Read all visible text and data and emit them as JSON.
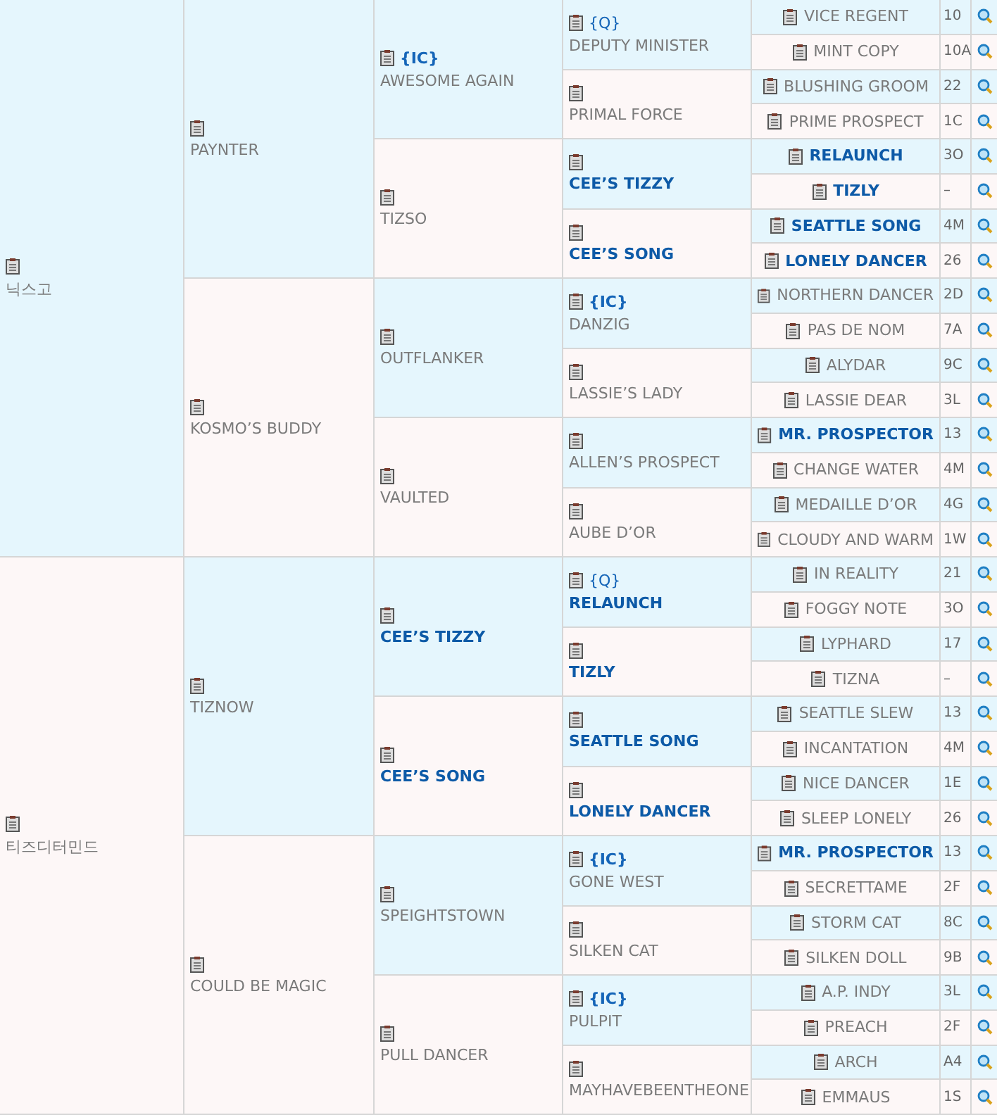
{
  "pedigree": [
    {
      "name": "닉스고",
      "highlighted": false,
      "children": [
        {
          "name": "PAYNTER",
          "highlighted": false,
          "children": [
            {
              "name": "AWESOME AGAIN",
              "tag": "{IC}",
              "highlighted": false,
              "children": [
                {
                  "name": "DEPUTY MINISTER",
                  "tag": "{Q}",
                  "highlighted": false,
                  "children": [
                    {
                      "name": "VICE REGENT",
                      "highlighted": false,
                      "code": "10"
                    },
                    {
                      "name": "MINT COPY",
                      "highlighted": false,
                      "code": "10A"
                    }
                  ]
                },
                {
                  "name": "PRIMAL FORCE",
                  "highlighted": false,
                  "children": [
                    {
                      "name": "BLUSHING GROOM",
                      "highlighted": false,
                      "code": "22"
                    },
                    {
                      "name": "PRIME PROSPECT",
                      "highlighted": false,
                      "code": "1C"
                    }
                  ]
                }
              ]
            },
            {
              "name": "TIZSO",
              "highlighted": false,
              "children": [
                {
                  "name": "CEE’S TIZZY",
                  "highlighted": true,
                  "children": [
                    {
                      "name": "RELAUNCH",
                      "highlighted": true,
                      "code": "3O"
                    },
                    {
                      "name": "TIZLY",
                      "highlighted": true,
                      "code": "–"
                    }
                  ]
                },
                {
                  "name": "CEE’S SONG",
                  "highlighted": true,
                  "children": [
                    {
                      "name": "SEATTLE SONG",
                      "highlighted": true,
                      "code": "4M"
                    },
                    {
                      "name": "LONELY DANCER",
                      "highlighted": true,
                      "code": "26"
                    }
                  ]
                }
              ]
            }
          ]
        },
        {
          "name": "KOSMO’S BUDDY",
          "highlighted": false,
          "children": [
            {
              "name": "OUTFLANKER",
              "highlighted": false,
              "children": [
                {
                  "name": "DANZIG",
                  "tag": "{IC}",
                  "highlighted": false,
                  "children": [
                    {
                      "name": "NORTHERN DANCER",
                      "highlighted": false,
                      "code": "2D"
                    },
                    {
                      "name": "PAS DE NOM",
                      "highlighted": false,
                      "code": "7A"
                    }
                  ]
                },
                {
                  "name": "LASSIE’S LADY",
                  "highlighted": false,
                  "children": [
                    {
                      "name": "ALYDAR",
                      "highlighted": false,
                      "code": "9C"
                    },
                    {
                      "name": "LASSIE DEAR",
                      "highlighted": false,
                      "code": "3L"
                    }
                  ]
                }
              ]
            },
            {
              "name": "VAULTED",
              "highlighted": false,
              "children": [
                {
                  "name": "ALLEN’S PROSPECT",
                  "highlighted": false,
                  "children": [
                    {
                      "name": "MR. PROSPECTOR",
                      "highlighted": true,
                      "code": "13"
                    },
                    {
                      "name": "CHANGE WATER",
                      "highlighted": false,
                      "code": "4M"
                    }
                  ]
                },
                {
                  "name": "AUBE D’OR",
                  "highlighted": false,
                  "children": [
                    {
                      "name": "MEDAILLE D’OR",
                      "highlighted": false,
                      "code": "4G"
                    },
                    {
                      "name": "CLOUDY AND WARM",
                      "highlighted": false,
                      "code": "1W"
                    }
                  ]
                }
              ]
            }
          ]
        }
      ]
    },
    {
      "name": "티즈디터민드",
      "highlighted": false,
      "children": [
        {
          "name": "TIZNOW",
          "highlighted": false,
          "children": [
            {
              "name": "CEE’S TIZZY",
              "highlighted": true,
              "children": [
                {
                  "name": "RELAUNCH",
                  "tag": "{Q}",
                  "highlighted": true,
                  "children": [
                    {
                      "name": "IN REALITY",
                      "highlighted": false,
                      "code": "21"
                    },
                    {
                      "name": "FOGGY NOTE",
                      "highlighted": false,
                      "code": "3O"
                    }
                  ]
                },
                {
                  "name": "TIZLY",
                  "highlighted": true,
                  "children": [
                    {
                      "name": "LYPHARD",
                      "highlighted": false,
                      "code": "17"
                    },
                    {
                      "name": "TIZNA",
                      "highlighted": false,
                      "code": "–"
                    }
                  ]
                }
              ]
            },
            {
              "name": "CEE’S SONG",
              "highlighted": true,
              "children": [
                {
                  "name": "SEATTLE SONG",
                  "highlighted": true,
                  "children": [
                    {
                      "name": "SEATTLE SLEW",
                      "highlighted": false,
                      "code": "13"
                    },
                    {
                      "name": "INCANTATION",
                      "highlighted": false,
                      "code": "4M"
                    }
                  ]
                },
                {
                  "name": "LONELY DANCER",
                  "highlighted": true,
                  "children": [
                    {
                      "name": "NICE DANCER",
                      "highlighted": false,
                      "code": "1E"
                    },
                    {
                      "name": "SLEEP LONELY",
                      "highlighted": false,
                      "code": "26"
                    }
                  ]
                }
              ]
            }
          ]
        },
        {
          "name": "COULD BE MAGIC",
          "highlighted": false,
          "children": [
            {
              "name": "SPEIGHTSTOWN",
              "highlighted": false,
              "children": [
                {
                  "name": "GONE WEST",
                  "tag": "{IC}",
                  "highlighted": false,
                  "children": [
                    {
                      "name": "MR. PROSPECTOR",
                      "highlighted": true,
                      "code": "13"
                    },
                    {
                      "name": "SECRETTAME",
                      "highlighted": false,
                      "code": "2F"
                    }
                  ]
                },
                {
                  "name": "SILKEN CAT",
                  "highlighted": false,
                  "children": [
                    {
                      "name": "STORM CAT",
                      "highlighted": false,
                      "code": "8C"
                    },
                    {
                      "name": "SILKEN DOLL",
                      "highlighted": false,
                      "code": "9B"
                    }
                  ]
                }
              ]
            },
            {
              "name": "PULL DANCER",
              "highlighted": false,
              "children": [
                {
                  "name": "PULPIT",
                  "tag": "{IC}",
                  "highlighted": false,
                  "children": [
                    {
                      "name": "A.P. INDY",
                      "highlighted": false,
                      "code": "3L"
                    },
                    {
                      "name": "PREACH",
                      "highlighted": false,
                      "code": "2F"
                    }
                  ]
                },
                {
                  "name": "MAYHAVEBEENTHEONE",
                  "highlighted": false,
                  "children": [
                    {
                      "name": "ARCH",
                      "highlighted": false,
                      "code": "A4"
                    },
                    {
                      "name": "EMMAUS",
                      "highlighted": false,
                      "code": "1S"
                    }
                  ]
                }
              ]
            }
          ]
        }
      ]
    }
  ]
}
